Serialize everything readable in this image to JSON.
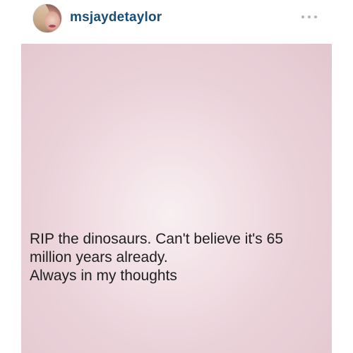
{
  "header": {
    "username": "msjaydetaylor",
    "more_icon": "more-options-icon"
  },
  "post": {
    "lines": [
      "RIP the dinosaurs. Can't believe it's 65",
      "million years already.",
      "Always in my thoughts"
    ],
    "background_color": "#efd9df"
  },
  "colors": {
    "username": "#1a4d75",
    "text": "#1e1e1e"
  }
}
